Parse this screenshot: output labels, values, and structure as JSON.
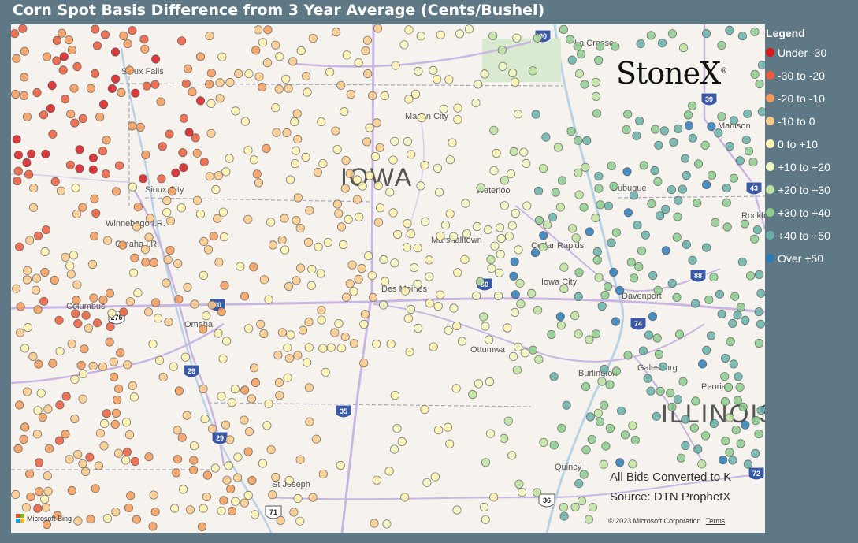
{
  "title": "Corn Spot Basis Difference from 3 Year Average (Cents/Bushel)",
  "legend": {
    "title": "Legend",
    "items": [
      {
        "label": "Under -30",
        "color": "#d7191c"
      },
      {
        "label": "-30 to -20",
        "color": "#ec5a3a"
      },
      {
        "label": "-20 to -10",
        "color": "#f49a58"
      },
      {
        "label": "-10 to 0",
        "color": "#fbc98a"
      },
      {
        "label": "0 to +10",
        "color": "#fff3b0"
      },
      {
        "label": "+10 to +20",
        "color": "#f2f6c0"
      },
      {
        "label": "+20 to +30",
        "color": "#bde3a0"
      },
      {
        "label": "+30 to +40",
        "color": "#8ccc8e"
      },
      {
        "label": "+40 to +50",
        "color": "#66b0a8"
      },
      {
        "label": "Over +50",
        "color": "#2b7bb9"
      }
    ]
  },
  "brand": "StoneX",
  "notes": {
    "conversion": "All Bids Converted to K",
    "source": "Source: DTN ProphetX"
  },
  "map": {
    "state_labels": [
      "IOWA",
      "ILLINOIS"
    ],
    "cities": [
      "Sioux Falls",
      "Mason City",
      "La Crosse",
      "Madison",
      "Waterloo",
      "Dubuque",
      "Rockford",
      "Sioux City",
      "Winnebago I.R.",
      "Omaha I.R.",
      "Marshalltown",
      "Cedar Rapids",
      "Iowa City",
      "Davenport",
      "Des Moines",
      "Columbus",
      "Omaha",
      "Ottumwa",
      "Burlington",
      "Galesburg",
      "Peoria",
      "Quincy",
      "St Joseph"
    ],
    "highway_shields": [
      "90",
      "39",
      "43",
      "88",
      "80",
      "74",
      "275",
      "80",
      "29",
      "35",
      "29",
      "36",
      "71",
      "72"
    ],
    "attribution": {
      "bing": "Microsoft Bing",
      "copyright": "© 2023 Microsoft Corporation",
      "terms": "Terms"
    }
  }
}
